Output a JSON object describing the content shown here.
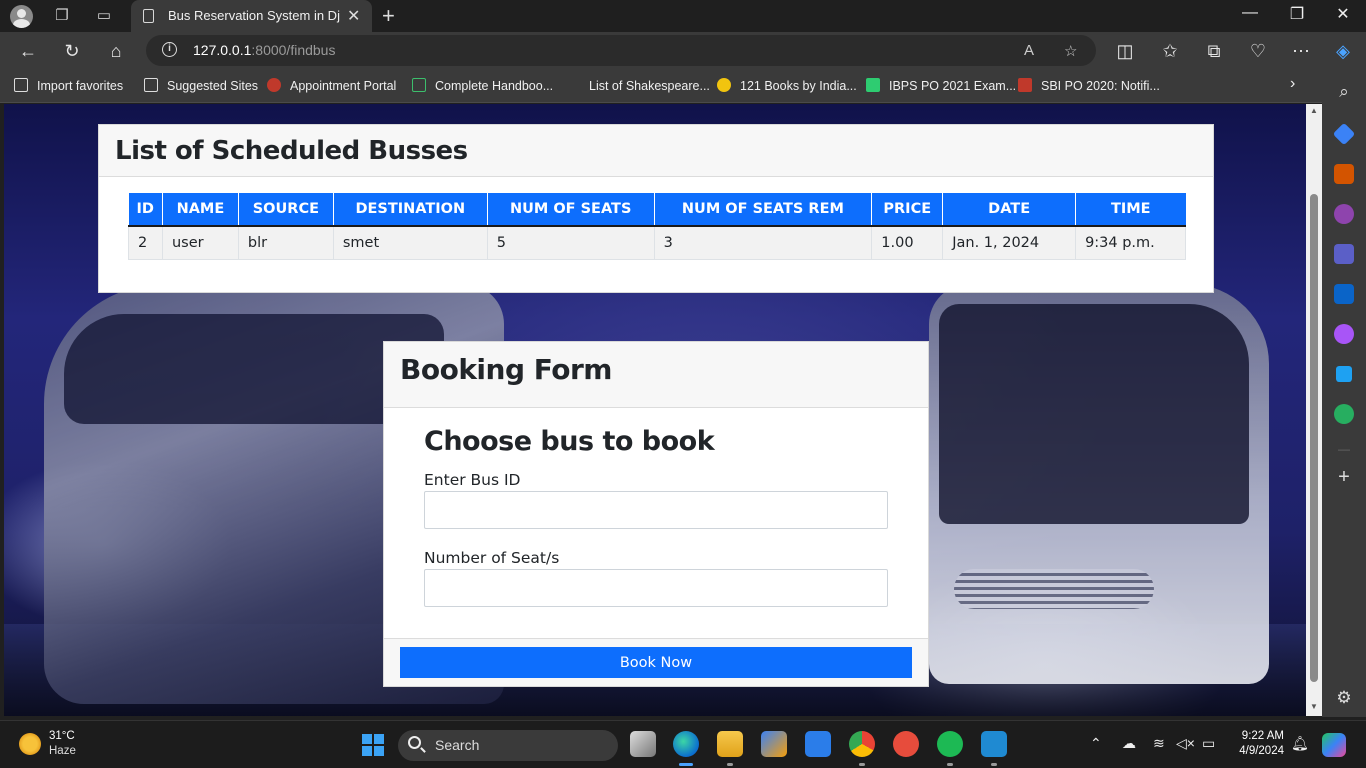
{
  "browser": {
    "tab_title": "Bus Reservation System in Django",
    "url_host": "127.0.0.1",
    "url_rest": ":8000/findbus"
  },
  "favorites": [
    {
      "label": "Import favorites"
    },
    {
      "label": "Suggested Sites"
    },
    {
      "label": "Appointment Portal"
    },
    {
      "label": "Complete Handboo..."
    },
    {
      "label": "List of Shakespeare..."
    },
    {
      "label": "121 Books by India..."
    },
    {
      "label": "IBPS PO 2021 Exam..."
    },
    {
      "label": "SBI PO 2020: Notifi..."
    }
  ],
  "bus_list": {
    "title": "List of Scheduled Busses",
    "headers": [
      "ID",
      "NAME",
      "SOURCE",
      "DESTINATION",
      "NUM OF SEATS",
      "NUM OF SEATS REM",
      "PRICE",
      "DATE",
      "TIME"
    ],
    "rows": [
      [
        "2",
        "user",
        "blr",
        "smet",
        "5",
        "3",
        "1.00",
        "Jan. 1, 2024",
        "9:34 p.m."
      ]
    ]
  },
  "booking": {
    "title": "Booking Form",
    "subtitle": "Choose bus to book",
    "bus_id_label": "Enter Bus ID",
    "bus_id_value": "",
    "seats_label": "Number of Seat/s",
    "seats_value": "",
    "submit_label": "Book Now"
  },
  "taskbar": {
    "temperature": "31°C",
    "weather": "Haze",
    "search_placeholder": "Search",
    "time": "9:22 AM",
    "date": "4/9/2024"
  },
  "colors": {
    "primary": "#0d6efd",
    "header_bg": "#f7f7f7"
  }
}
